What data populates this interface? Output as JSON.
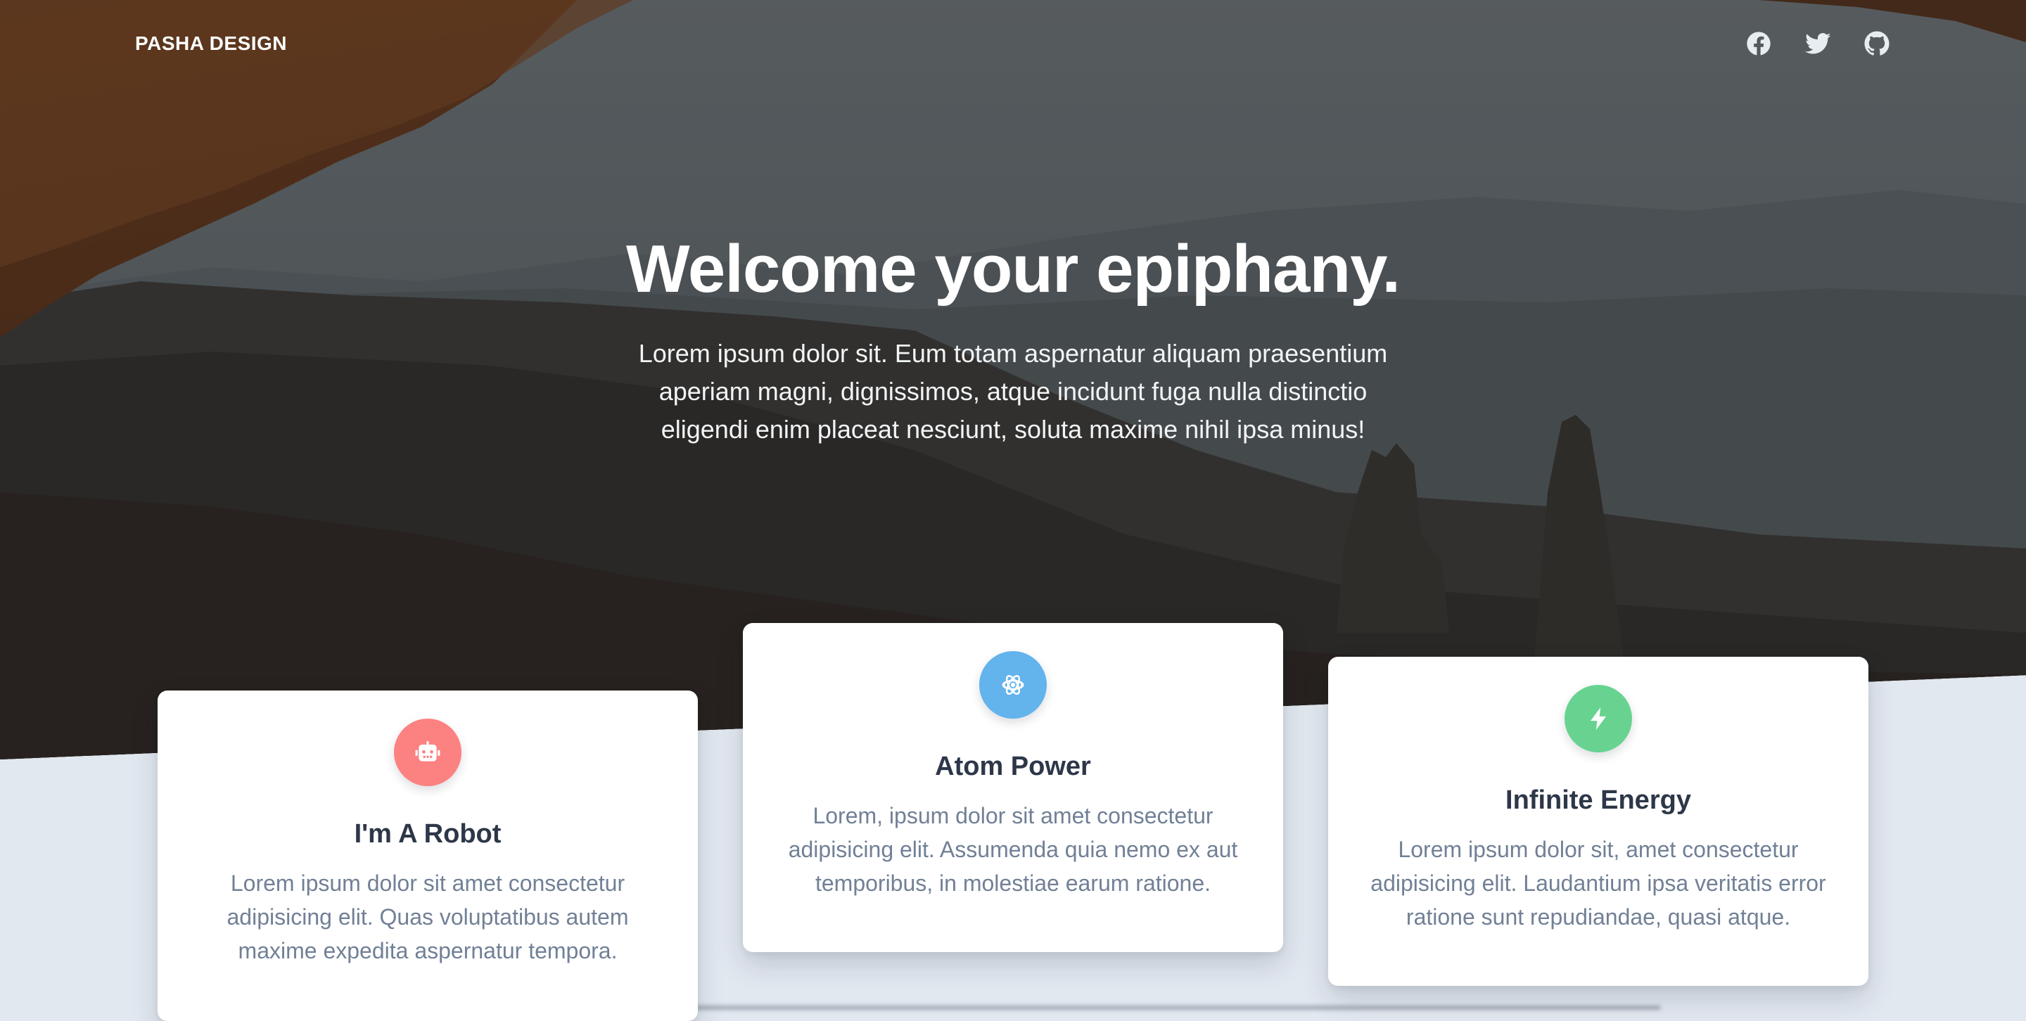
{
  "header": {
    "brand": "PASHA DESIGN",
    "social": [
      {
        "icon": "facebook-icon"
      },
      {
        "icon": "twitter-icon"
      },
      {
        "icon": "github-icon"
      }
    ]
  },
  "hero": {
    "title": "Welcome your epiphany.",
    "text": "Lorem ipsum dolor sit. Eum totam aspernatur aliquam praesentium aperiam magni, dignissimos, atque incidunt fuga nulla distinctio eligendi enim placeat nesciunt, soluta maxime nihil ipsa minus!"
  },
  "cards": [
    {
      "icon": "robot-icon",
      "color": "#fc8181",
      "title": "I'm A Robot",
      "text": "Lorem ipsum dolor sit amet consectetur adipisicing elit. Quas voluptatibus autem maxime expedita aspernatur tempora."
    },
    {
      "icon": "atom-icon",
      "color": "#63b3ed",
      "title": "Atom Power",
      "text": "Lorem, ipsum dolor sit amet consectetur adipisicing elit. Assumenda quia nemo ex aut temporibus, in molestiae earum ratione."
    },
    {
      "icon": "lightning-bolt-icon",
      "color": "#68d391",
      "title": "Infinite Energy",
      "text": "Lorem ipsum dolor sit, amet consectetur adipisicing elit. Laudantium ipsa veritatis error ratione sunt repudiandae, quasi atque."
    }
  ]
}
